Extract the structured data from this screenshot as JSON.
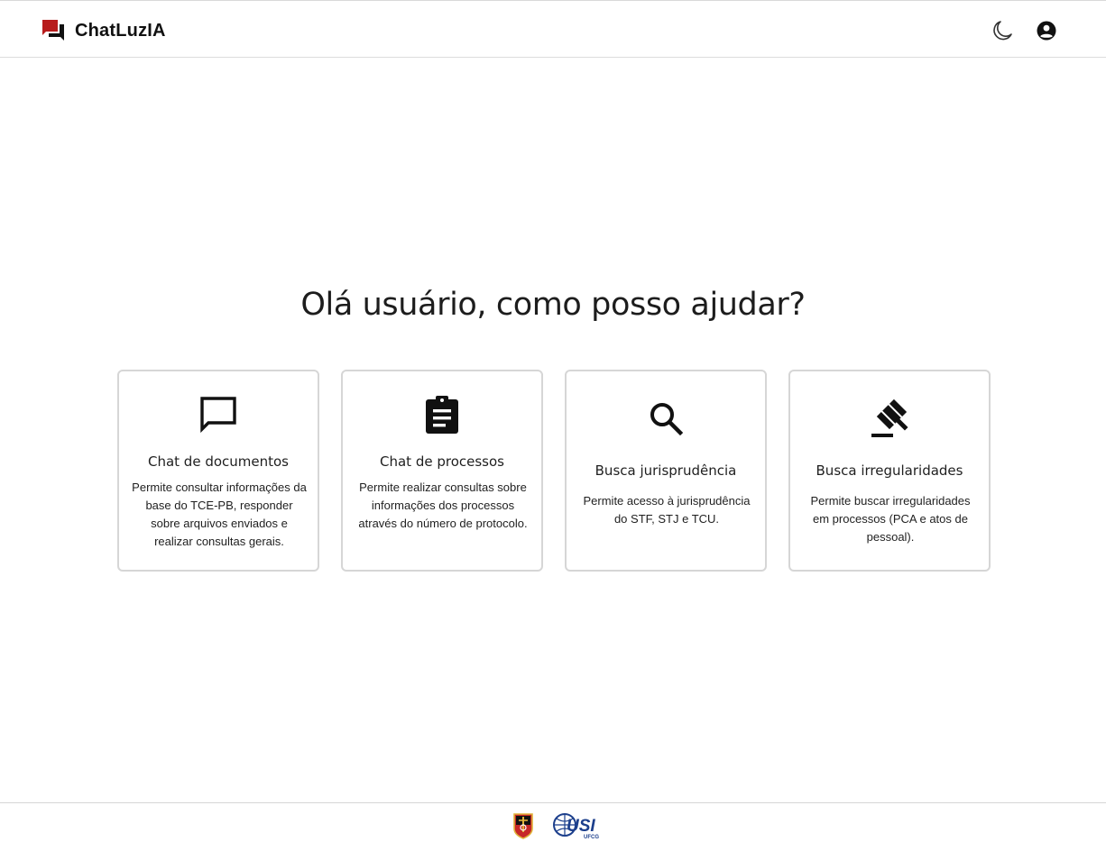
{
  "header": {
    "app_name": "ChatLuzIA",
    "brand_color": "#b71c1c",
    "brand_icon": "chat-bubbles-icon",
    "theme_toggle_icon": "moon-icon",
    "profile_icon": "account-circle-icon"
  },
  "main": {
    "greeting": "Olá usuário, como posso ajudar?",
    "cards": [
      {
        "icon": "chat-bubble-outline-icon",
        "title": "Chat de documentos",
        "description": "Permite consultar informações da base do TCE-PB, responder sobre arquivos enviados e realizar consultas gerais."
      },
      {
        "icon": "clipboard-icon",
        "title": "Chat de processos",
        "description": "Permite realizar consultas sobre informações dos processos através do número de protocolo."
      },
      {
        "icon": "search-icon",
        "title": "Busca jurisprudência",
        "description": "Permite acesso à jurisprudência do STF, STJ e TCU."
      },
      {
        "icon": "gavel-icon",
        "title": "Busca irregularidades",
        "description": "Permite buscar irregularidades em processos (PCA e atos de pessoal)."
      }
    ]
  },
  "footer": {
    "logos": [
      "tce-pb-crest-logo",
      "usi-ufcg-logo"
    ],
    "usi_logo_text": "USI",
    "usi_logo_subtext": "UFCG"
  }
}
